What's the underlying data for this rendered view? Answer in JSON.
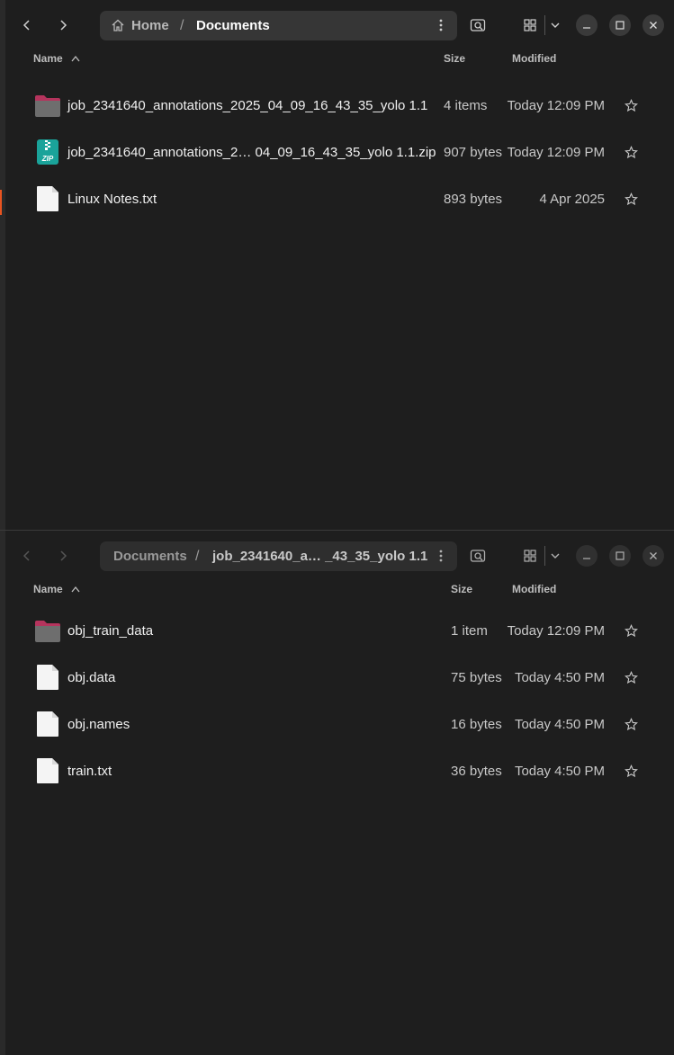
{
  "window1": {
    "breadcrumb": [
      "Home",
      "Documents"
    ],
    "columns": {
      "name": "Name",
      "size": "Size",
      "modified": "Modified"
    },
    "files": [
      {
        "name": "job_2341640_annotations_2025_04_09_16_43_35_yolo 1.1",
        "size": "4 items",
        "modified": "Today 12:09 PM",
        "icon": "folder-icon"
      },
      {
        "name": "job_2341640_annotations_2… 04_09_16_43_35_yolo 1.1.zip",
        "size": "907 bytes",
        "modified": "Today 12:09 PM",
        "icon": "zip-archive-icon"
      },
      {
        "name": "Linux Notes.txt",
        "size": "893 bytes",
        "modified": "4 Apr 2025",
        "icon": "text-file-icon"
      }
    ]
  },
  "window2": {
    "breadcrumb": [
      "Documents",
      "job_2341640_a… _43_35_yolo 1.1"
    ],
    "columns": {
      "name": "Name",
      "size": "Size",
      "modified": "Modified"
    },
    "files": [
      {
        "name": "obj_train_data",
        "size": "1 item",
        "modified": "Today 12:09 PM",
        "icon": "folder-icon"
      },
      {
        "name": "obj.data",
        "size": "75 bytes",
        "modified": "Today 4:50 PM",
        "icon": "text-file-icon"
      },
      {
        "name": "obj.names",
        "size": "16 bytes",
        "modified": "Today 4:50 PM",
        "icon": "text-file-icon"
      },
      {
        "name": "train.txt",
        "size": "36 bytes",
        "modified": "Today 4:50 PM",
        "icon": "text-file-icon"
      }
    ]
  },
  "colors": {
    "background": "#1e1e1e",
    "pathbar": "#363636",
    "accent": "#e95420",
    "folder": "#6e6e6e",
    "folder_tab": "#b5345d",
    "zip": "#1aa39a"
  }
}
